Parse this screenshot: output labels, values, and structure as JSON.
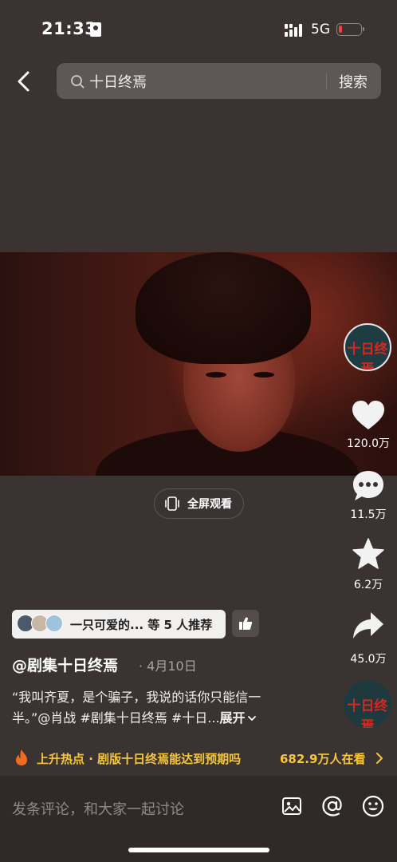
{
  "status_bar": {
    "time": "21:33",
    "network": "5G"
  },
  "search": {
    "query": "十日终焉",
    "button": "搜索"
  },
  "video": {
    "fullscreen_label": "全屏观看"
  },
  "right_rail": {
    "channel_logo": "十日终焉",
    "likes": "120.0万",
    "comments": "11.5万",
    "favorites": "6.2万",
    "shares": "45.0万"
  },
  "recommend": {
    "text": "一只可爱的... 等 5 人推荐"
  },
  "post": {
    "author": "@剧集十日终焉",
    "date": "· 4月10日",
    "desc_line1": "“我叫齐夏，是个骗子，我说的话你只能信一",
    "desc_line2": "半。”@肖战 #剧集十日终焉 #十日...",
    "expand": "展开"
  },
  "hot": {
    "text": "上升热点 · 剧版十日终焉能达到预期吗",
    "count": "682.9万人在看"
  },
  "comment_bar": {
    "placeholder": "发条评论，和大家一起讨论"
  },
  "colors": {
    "background": "#3a3331",
    "hot_accent": "#f6c73c",
    "logo_red": "#d6271f"
  },
  "icons": [
    "back-icon",
    "search-icon",
    "like-icon",
    "comment-icon",
    "star-icon",
    "share-icon",
    "thumb-up-icon",
    "fire-icon",
    "image-icon",
    "at-icon",
    "emoji-icon"
  ]
}
